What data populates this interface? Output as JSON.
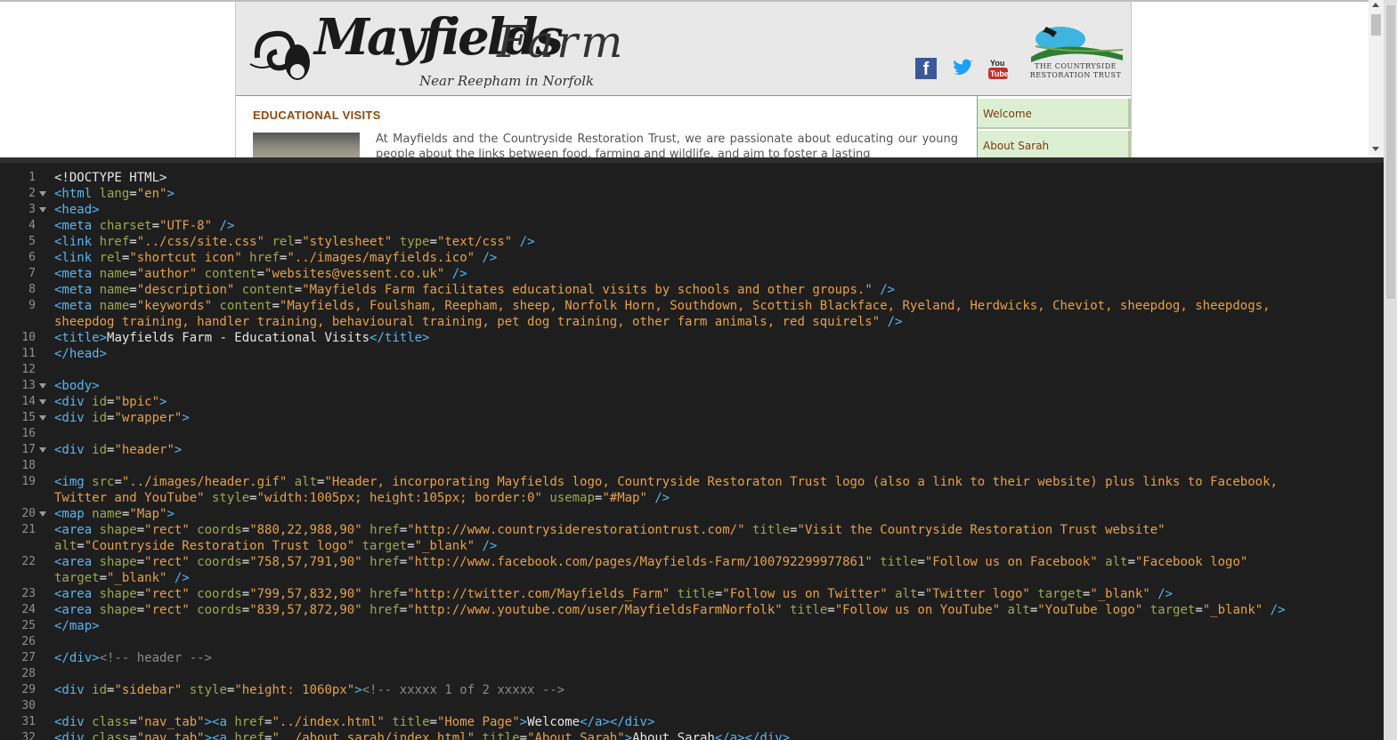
{
  "preview": {
    "logo": {
      "brand": "Mayfields",
      "farm": "Farm",
      "subtitle": "Near Reepham in Norfolk"
    },
    "crt_logo_text": "THE COUNTRYSIDE RESTORATION TRUST",
    "social": [
      "facebook-icon",
      "twitter-icon",
      "youtube-icon"
    ],
    "section_title": "EDUCATIONAL VISITS",
    "intro_text": "At Mayfields and the Countryside Restoration Trust, we are passionate about educating our young people about the links between food, farming and wildlife, and aim to foster a lasting",
    "nav_tabs": [
      "Welcome",
      "About Sarah"
    ]
  },
  "editor": {
    "lines": [
      {
        "n": "1",
        "fold": false,
        "tokens": [
          [
            "text",
            "<!DOCTYPE HTML>"
          ]
        ]
      },
      {
        "n": "2",
        "fold": true,
        "tokens": [
          [
            "tag",
            "<html "
          ],
          [
            "attr",
            "lang"
          ],
          [
            "text",
            "="
          ],
          [
            "val",
            "\"en\""
          ],
          [
            "tag",
            ">"
          ]
        ]
      },
      {
        "n": "3",
        "fold": true,
        "tokens": [
          [
            "tag",
            "<head>"
          ]
        ]
      },
      {
        "n": "4",
        "fold": false,
        "tokens": [
          [
            "tag",
            "<meta "
          ],
          [
            "attr",
            "charset"
          ],
          [
            "text",
            "="
          ],
          [
            "val",
            "\"UTF-8\""
          ],
          [
            "tag",
            " />"
          ]
        ]
      },
      {
        "n": "5",
        "fold": false,
        "tokens": [
          [
            "tag",
            "<link "
          ],
          [
            "attr",
            "href"
          ],
          [
            "text",
            "="
          ],
          [
            "val",
            "\"../css/site.css\""
          ],
          [
            "attr",
            " rel"
          ],
          [
            "text",
            "="
          ],
          [
            "val",
            "\"stylesheet\""
          ],
          [
            "attr",
            " type"
          ],
          [
            "text",
            "="
          ],
          [
            "val",
            "\"text/css\""
          ],
          [
            "tag",
            " />"
          ]
        ]
      },
      {
        "n": "6",
        "fold": false,
        "tokens": [
          [
            "tag",
            "<link "
          ],
          [
            "attr",
            "rel"
          ],
          [
            "text",
            "="
          ],
          [
            "val",
            "\"shortcut icon\""
          ],
          [
            "attr",
            " href"
          ],
          [
            "text",
            "="
          ],
          [
            "val",
            "\"../images/mayfields.ico\""
          ],
          [
            "tag",
            " />"
          ]
        ]
      },
      {
        "n": "7",
        "fold": false,
        "tokens": [
          [
            "tag",
            "<meta "
          ],
          [
            "attr",
            "name"
          ],
          [
            "text",
            "="
          ],
          [
            "val",
            "\"author\""
          ],
          [
            "attr",
            " content"
          ],
          [
            "text",
            "="
          ],
          [
            "val",
            "\"websites@vessent.co.uk\""
          ],
          [
            "tag",
            " />"
          ]
        ]
      },
      {
        "n": "8",
        "fold": false,
        "tokens": [
          [
            "tag",
            "<meta "
          ],
          [
            "attr",
            "name"
          ],
          [
            "text",
            "="
          ],
          [
            "val",
            "\"description\""
          ],
          [
            "attr",
            " content"
          ],
          [
            "text",
            "="
          ],
          [
            "val",
            "\"Mayfields Farm facilitates educational visits by schools and other groups.\""
          ],
          [
            "tag",
            " />"
          ]
        ]
      },
      {
        "n": "9",
        "fold": false,
        "tokens": [
          [
            "tag",
            "<meta "
          ],
          [
            "attr",
            "name"
          ],
          [
            "text",
            "="
          ],
          [
            "val",
            "\"keywords\""
          ],
          [
            "attr",
            " content"
          ],
          [
            "text",
            "="
          ],
          [
            "val",
            "\"Mayfields, Foulsham, Reepham, sheep, Norfolk Horn, Southdown, Scottish Blackface, Ryeland, Herdwicks, Cheviot, sheepdog, sheepdogs,"
          ]
        ]
      },
      {
        "n": "",
        "fold": false,
        "tokens": [
          [
            "val",
            "sheepdog training, handler training, behavioural training, pet dog training, other farm animals, red squirels\""
          ],
          [
            "tag",
            " />"
          ]
        ]
      },
      {
        "n": "10",
        "fold": false,
        "tokens": [
          [
            "tag",
            "<title>"
          ],
          [
            "text",
            "Mayfields Farm - Educational Visits"
          ],
          [
            "tag",
            "</title>"
          ]
        ]
      },
      {
        "n": "11",
        "fold": false,
        "tokens": [
          [
            "tag",
            "</head>"
          ]
        ]
      },
      {
        "n": "12",
        "fold": false,
        "tokens": []
      },
      {
        "n": "13",
        "fold": true,
        "tokens": [
          [
            "tag",
            "<body>"
          ]
        ]
      },
      {
        "n": "14",
        "fold": true,
        "tokens": [
          [
            "tag",
            "<div "
          ],
          [
            "attr",
            "id"
          ],
          [
            "text",
            "="
          ],
          [
            "val",
            "\"bpic\""
          ],
          [
            "tag",
            ">"
          ]
        ]
      },
      {
        "n": "15",
        "fold": true,
        "tokens": [
          [
            "tag",
            "<div "
          ],
          [
            "attr",
            "id"
          ],
          [
            "text",
            "="
          ],
          [
            "val",
            "\"wrapper\""
          ],
          [
            "tag",
            ">"
          ]
        ]
      },
      {
        "n": "16",
        "fold": false,
        "tokens": []
      },
      {
        "n": "17",
        "fold": true,
        "tokens": [
          [
            "tag",
            "<div "
          ],
          [
            "attr",
            "id"
          ],
          [
            "text",
            "="
          ],
          [
            "val",
            "\"header\""
          ],
          [
            "tag",
            ">"
          ]
        ]
      },
      {
        "n": "18",
        "fold": false,
        "tokens": []
      },
      {
        "n": "19",
        "fold": false,
        "tokens": [
          [
            "tag",
            "<img "
          ],
          [
            "attr",
            "src"
          ],
          [
            "text",
            "="
          ],
          [
            "val",
            "\"../images/header.gif\""
          ],
          [
            "attr",
            " alt"
          ],
          [
            "text",
            "="
          ],
          [
            "val",
            "\"Header, incorporating Mayfields logo, Countryside Restoraton Trust logo (also a link to their website) plus links to Facebook,"
          ]
        ]
      },
      {
        "n": "",
        "fold": false,
        "tokens": [
          [
            "val",
            "Twitter and YouTube\""
          ],
          [
            "attr",
            " style"
          ],
          [
            "text",
            "="
          ],
          [
            "val",
            "\"width:1005px; height:105px; border:0\""
          ],
          [
            "attr",
            " usemap"
          ],
          [
            "text",
            "="
          ],
          [
            "val",
            "\"#Map\""
          ],
          [
            "tag",
            " />"
          ]
        ]
      },
      {
        "n": "20",
        "fold": true,
        "tokens": [
          [
            "tag",
            "<map "
          ],
          [
            "attr",
            "name"
          ],
          [
            "text",
            "="
          ],
          [
            "val",
            "\"Map\""
          ],
          [
            "tag",
            ">"
          ]
        ]
      },
      {
        "n": "21",
        "fold": false,
        "tokens": [
          [
            "tag",
            "<area "
          ],
          [
            "attr",
            "shape"
          ],
          [
            "text",
            "="
          ],
          [
            "val",
            "\"rect\""
          ],
          [
            "attr",
            " coords"
          ],
          [
            "text",
            "="
          ],
          [
            "val",
            "\"880,22,988,90\""
          ],
          [
            "attr",
            " href"
          ],
          [
            "text",
            "="
          ],
          [
            "val",
            "\"http://www.countrysiderestorationtrust.com/\""
          ],
          [
            "attr",
            " title"
          ],
          [
            "text",
            "="
          ],
          [
            "val",
            "\"Visit the Countryside Restoration Trust website\""
          ]
        ]
      },
      {
        "n": "",
        "fold": false,
        "tokens": [
          [
            "attr",
            "alt"
          ],
          [
            "text",
            "="
          ],
          [
            "val",
            "\"Countryside Restoration Trust logo\""
          ],
          [
            "attr",
            " target"
          ],
          [
            "text",
            "="
          ],
          [
            "val",
            "\"_blank\""
          ],
          [
            "tag",
            " />"
          ]
        ]
      },
      {
        "n": "22",
        "fold": false,
        "tokens": [
          [
            "tag",
            "<area "
          ],
          [
            "attr",
            "shape"
          ],
          [
            "text",
            "="
          ],
          [
            "val",
            "\"rect\""
          ],
          [
            "attr",
            " coords"
          ],
          [
            "text",
            "="
          ],
          [
            "val",
            "\"758,57,791,90\""
          ],
          [
            "attr",
            " href"
          ],
          [
            "text",
            "="
          ],
          [
            "val",
            "\"http://www.facebook.com/pages/Mayfields-Farm/100792299977861\""
          ],
          [
            "attr",
            " title"
          ],
          [
            "text",
            "="
          ],
          [
            "val",
            "\"Follow us on Facebook\""
          ],
          [
            "attr",
            " alt"
          ],
          [
            "text",
            "="
          ],
          [
            "val",
            "\"Facebook logo\""
          ]
        ]
      },
      {
        "n": "",
        "fold": false,
        "tokens": [
          [
            "attr",
            "target"
          ],
          [
            "text",
            "="
          ],
          [
            "val",
            "\"_blank\""
          ],
          [
            "tag",
            " />"
          ]
        ]
      },
      {
        "n": "23",
        "fold": false,
        "tokens": [
          [
            "tag",
            "<area "
          ],
          [
            "attr",
            "shape"
          ],
          [
            "text",
            "="
          ],
          [
            "val",
            "\"rect\""
          ],
          [
            "attr",
            " coords"
          ],
          [
            "text",
            "="
          ],
          [
            "val",
            "\"799,57,832,90\""
          ],
          [
            "attr",
            " href"
          ],
          [
            "text",
            "="
          ],
          [
            "val",
            "\"http://twitter.com/Mayfields_Farm\""
          ],
          [
            "attr",
            " title"
          ],
          [
            "text",
            "="
          ],
          [
            "val",
            "\"Follow us on Twitter\""
          ],
          [
            "attr",
            " alt"
          ],
          [
            "text",
            "="
          ],
          [
            "val",
            "\"Twitter logo\""
          ],
          [
            "attr",
            " target"
          ],
          [
            "text",
            "="
          ],
          [
            "val",
            "\"_blank\""
          ],
          [
            "tag",
            " />"
          ]
        ]
      },
      {
        "n": "24",
        "fold": false,
        "tokens": [
          [
            "tag",
            "<area "
          ],
          [
            "attr",
            "shape"
          ],
          [
            "text",
            "="
          ],
          [
            "val",
            "\"rect\""
          ],
          [
            "attr",
            " coords"
          ],
          [
            "text",
            "="
          ],
          [
            "val",
            "\"839,57,872,90\""
          ],
          [
            "attr",
            " href"
          ],
          [
            "text",
            "="
          ],
          [
            "val",
            "\"http://www.youtube.com/user/MayfieldsFarmNorfolk\""
          ],
          [
            "attr",
            " title"
          ],
          [
            "text",
            "="
          ],
          [
            "val",
            "\"Follow us on YouTube\""
          ],
          [
            "attr",
            " alt"
          ],
          [
            "text",
            "="
          ],
          [
            "val",
            "\"YouTube logo\""
          ],
          [
            "attr",
            " target"
          ],
          [
            "text",
            "="
          ],
          [
            "val",
            "\"_blank\""
          ],
          [
            "tag",
            " />"
          ]
        ]
      },
      {
        "n": "25",
        "fold": false,
        "tokens": [
          [
            "tag",
            "</map>"
          ]
        ]
      },
      {
        "n": "26",
        "fold": false,
        "tokens": []
      },
      {
        "n": "27",
        "fold": false,
        "tokens": [
          [
            "tag",
            "</div>"
          ],
          [
            "com",
            "<!-- header -->"
          ]
        ]
      },
      {
        "n": "28",
        "fold": false,
        "tokens": []
      },
      {
        "n": "29",
        "fold": false,
        "tokens": [
          [
            "tag",
            "<div "
          ],
          [
            "attr",
            "id"
          ],
          [
            "text",
            "="
          ],
          [
            "val",
            "\"sidebar\""
          ],
          [
            "attr",
            " style"
          ],
          [
            "text",
            "="
          ],
          [
            "val",
            "\"height: 1060px\""
          ],
          [
            "tag",
            ">"
          ],
          [
            "com",
            "<!-- xxxxx 1 of 2 xxxxx -->"
          ]
        ]
      },
      {
        "n": "30",
        "fold": false,
        "tokens": []
      },
      {
        "n": "31",
        "fold": false,
        "tokens": [
          [
            "tag",
            "<div "
          ],
          [
            "attr",
            "class"
          ],
          [
            "text",
            "="
          ],
          [
            "val",
            "\"nav_tab\""
          ],
          [
            "tag",
            "><a "
          ],
          [
            "attr",
            "href"
          ],
          [
            "text",
            "="
          ],
          [
            "val",
            "\"../index.html\""
          ],
          [
            "attr",
            " title"
          ],
          [
            "text",
            "="
          ],
          [
            "val",
            "\"Home Page\""
          ],
          [
            "tag",
            ">"
          ],
          [
            "text",
            "Welcome"
          ],
          [
            "tag",
            "</a></div>"
          ]
        ]
      },
      {
        "n": "32",
        "fold": false,
        "tokens": [
          [
            "tag",
            "<div "
          ],
          [
            "attr",
            "class"
          ],
          [
            "text",
            "="
          ],
          [
            "val",
            "\"nav_tab\""
          ],
          [
            "tag",
            "><a "
          ],
          [
            "attr",
            "href"
          ],
          [
            "text",
            "="
          ],
          [
            "val",
            "\"../about_sarah/index.html\""
          ],
          [
            "attr",
            " title"
          ],
          [
            "text",
            "="
          ],
          [
            "val",
            "\"About Sarah\""
          ],
          [
            "tag",
            ">"
          ],
          [
            "text",
            "About Sarah"
          ],
          [
            "tag",
            "</a></div>"
          ]
        ]
      }
    ]
  }
}
